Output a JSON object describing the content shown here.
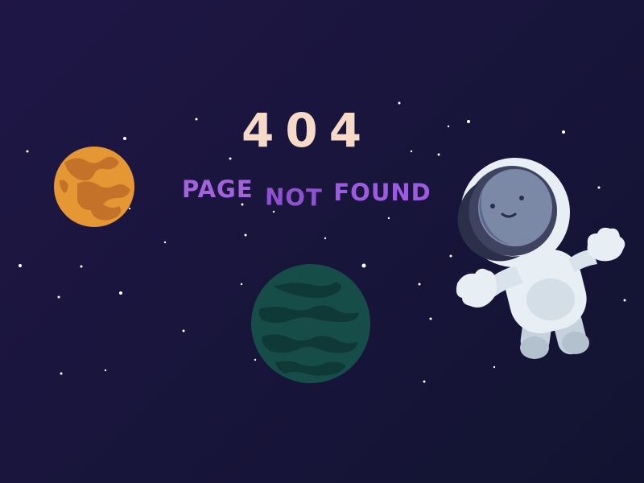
{
  "page": {
    "error_code": "404",
    "message": {
      "word1": "PAGE",
      "word2": "NOT",
      "word3": "FOUND"
    }
  },
  "illustration": {
    "elements": [
      "orange-planet",
      "teal-planet",
      "astronaut",
      "stars"
    ],
    "colors": {
      "background": "#19153c",
      "heading": "#f6d9c6",
      "subtitle": "#9d5cd8",
      "orange_planet": "#e59734",
      "teal_planet": "#174d49",
      "astronaut_suit": "#e7eef4",
      "visor": "#3f4360"
    }
  }
}
